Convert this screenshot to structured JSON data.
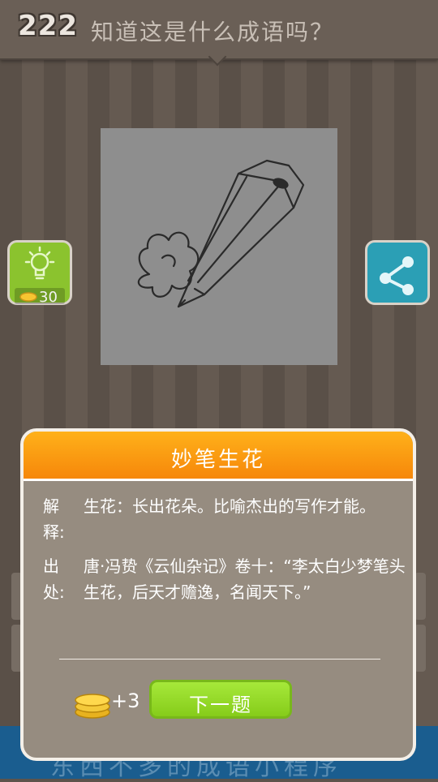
{
  "header": {
    "level": "222",
    "question": "知道这是什么成语吗？"
  },
  "hint_button": {
    "cost": "30"
  },
  "background_text": "东西不多的成语小程序",
  "dialog": {
    "title": "妙笔生花",
    "explain_label": "解释:",
    "explain_text": "生花：长出花朵。比喻杰出的写作才能。",
    "source_label": "出处:",
    "source_text": "唐·冯贽《云仙杂记》卷十：“李太白少梦笔头生花，后天才赡逸，名闻天下。”",
    "reward": "+3",
    "next_label": "下一题"
  },
  "colors": {
    "accent": "#f6870a",
    "hint": "#8bc32e",
    "share": "#2b9fb5",
    "next": "#8fd223"
  }
}
